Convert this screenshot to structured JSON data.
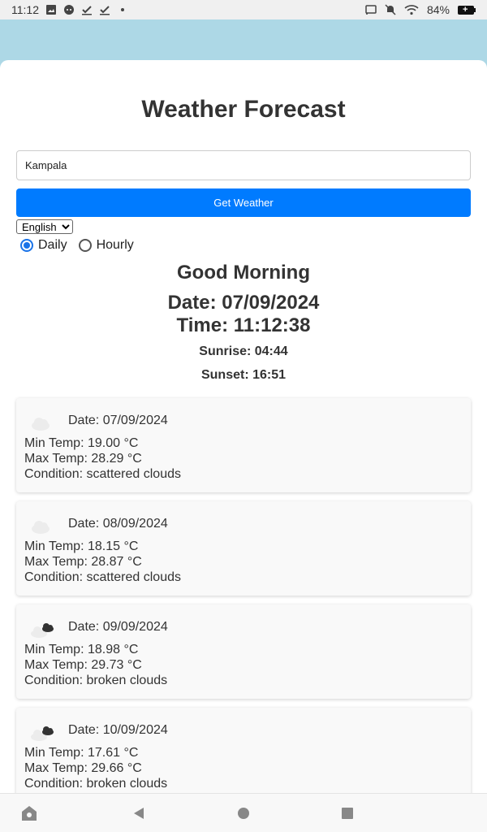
{
  "status_bar": {
    "time": "11:12",
    "battery": "84%",
    "left_icons": [
      "image-icon",
      "chat-icon",
      "check-icon",
      "check-icon",
      "dot-icon"
    ],
    "right_icons": [
      "cast-icon",
      "bell-off-icon",
      "wifi-icon",
      "battery-icon"
    ]
  },
  "app": {
    "title": "Weather Forecast",
    "city_input_value": "Kampala",
    "get_weather_label": "Get Weather",
    "language": "English",
    "modes": [
      {
        "label": "Daily",
        "checked": true
      },
      {
        "label": "Hourly",
        "checked": false
      }
    ],
    "greeting": "Good Morning",
    "date_text": "Date: 07/09/2024",
    "time_text": "Time: 11:12:38",
    "sunrise_text": "Sunrise: 04:44",
    "sunset_text": "Sunset: 16:51"
  },
  "forecast": [
    {
      "date": "Date: 07/09/2024",
      "min": "Min Temp: 19.00 °C",
      "max": "Max Temp: 28.29 °C",
      "condition": "Condition: scattered clouds",
      "icon": "scattered-clouds-icon"
    },
    {
      "date": "Date: 08/09/2024",
      "min": "Min Temp: 18.15 °C",
      "max": "Max Temp: 28.87 °C",
      "condition": "Condition: scattered clouds",
      "icon": "scattered-clouds-icon"
    },
    {
      "date": "Date: 09/09/2024",
      "min": "Min Temp: 18.98 °C",
      "max": "Max Temp: 29.73 °C",
      "condition": "Condition: broken clouds",
      "icon": "broken-clouds-icon"
    },
    {
      "date": "Date: 10/09/2024",
      "min": "Min Temp: 17.61 °C",
      "max": "Max Temp: 29.66 °C",
      "condition": "Condition: broken clouds",
      "icon": "broken-clouds-icon"
    }
  ],
  "nav_bar": {
    "icons": [
      "assistant-icon",
      "back-icon",
      "home-icon",
      "recents-icon"
    ]
  },
  "colors": {
    "background": "#add8e6",
    "button": "#007bff",
    "card": "#f9f9f9"
  }
}
